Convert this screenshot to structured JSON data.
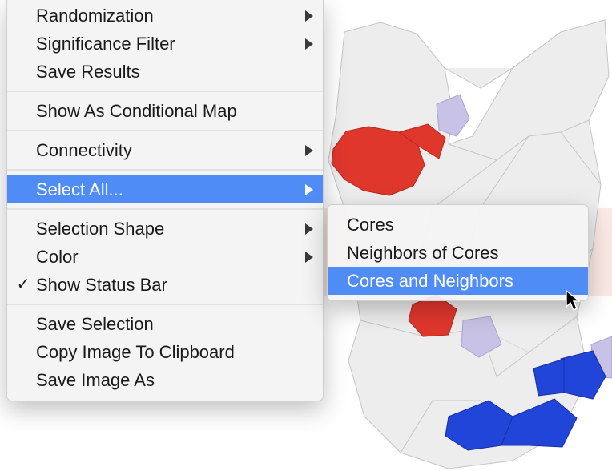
{
  "menu": {
    "randomization": "Randomization",
    "significance_filter": "Significance Filter",
    "save_results": "Save Results",
    "show_conditional_map": "Show As Conditional Map",
    "connectivity": "Connectivity",
    "select_all": "Select All...",
    "selection_shape": "Selection Shape",
    "color": "Color",
    "show_status_bar": "Show Status Bar",
    "save_selection": "Save Selection",
    "copy_image": "Copy Image To Clipboard",
    "save_image": "Save Image As"
  },
  "submenu": {
    "cores": "Cores",
    "neighbors_of_cores": "Neighbors of Cores",
    "cores_and_neighbors": "Cores and Neighbors"
  },
  "colors": {
    "menu_highlight": "#4f8cf6",
    "map_red": "#e0372d",
    "map_blue": "#2045d8",
    "map_lilac": "#c8c3e6",
    "map_neutral": "#ededed",
    "map_border": "#bcbcbc"
  }
}
